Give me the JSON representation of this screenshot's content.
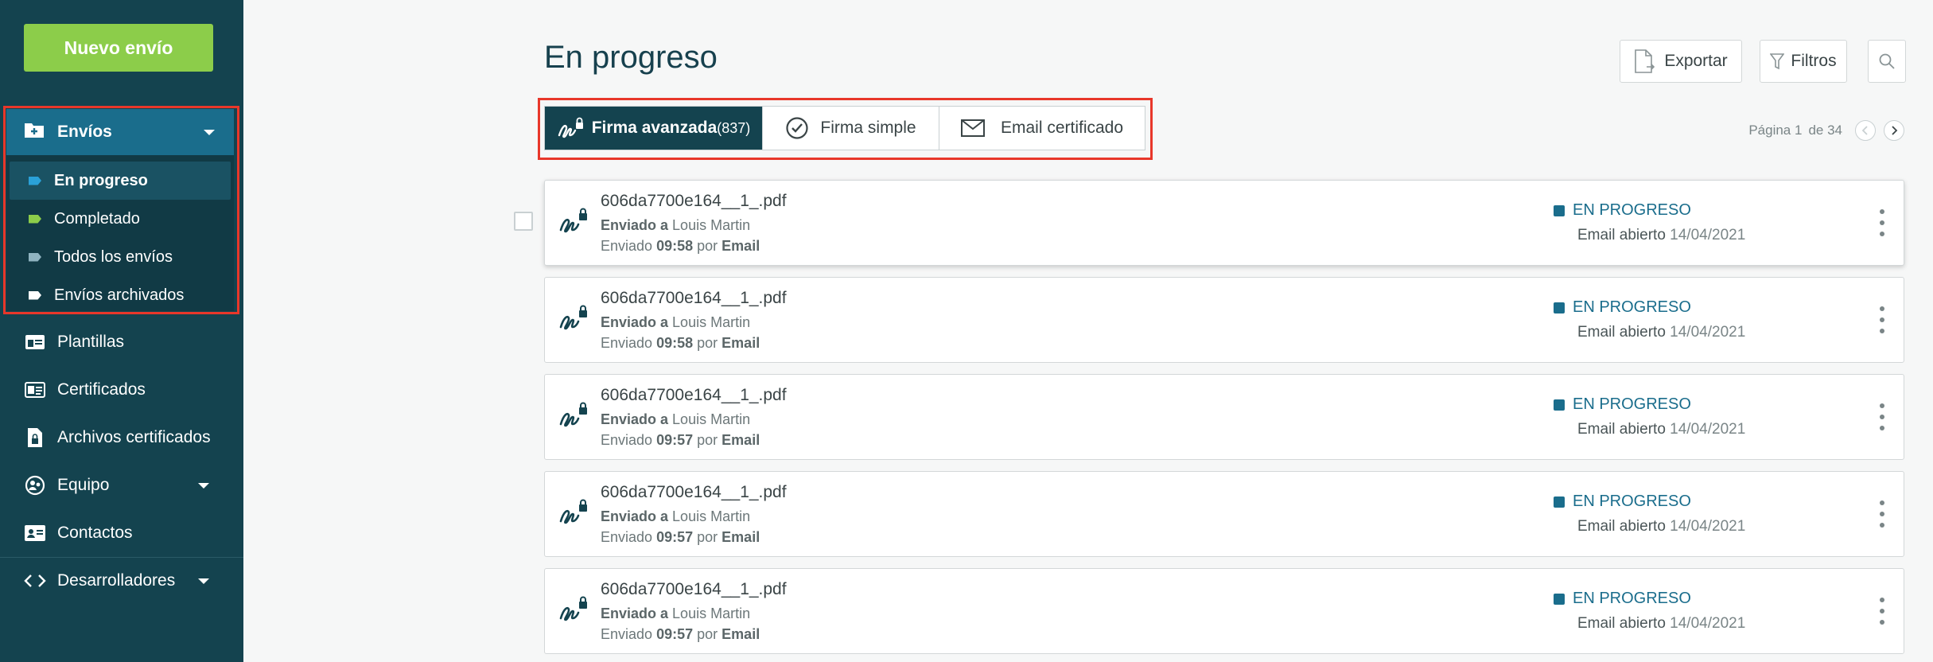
{
  "sidebar": {
    "new_button": "Nuevo envío",
    "envios_label": "Envíos",
    "sub_items": [
      {
        "label": "En progreso",
        "tag_color": "#2aa1d8"
      },
      {
        "label": "Completado",
        "tag_color": "#8ccd4a"
      },
      {
        "label": "Todos los envíos",
        "tag_color": "#8fb3c0"
      },
      {
        "label": "Envíos archivados",
        "tag_color": "#ffffff"
      }
    ],
    "nav_items": [
      {
        "label": "Plantillas",
        "icon": "template-icon"
      },
      {
        "label": "Certificados",
        "icon": "certificate-icon"
      },
      {
        "label": "Archivos certificados",
        "icon": "certified-file-icon"
      },
      {
        "label": "Equipo",
        "icon": "team-icon"
      },
      {
        "label": "Contactos",
        "icon": "contacts-icon"
      },
      {
        "label": "Desarrolladores",
        "icon": "code-icon"
      }
    ]
  },
  "main": {
    "title": "En progreso",
    "export_label": "Exportar",
    "filters_label": "Filtros",
    "tabs": [
      {
        "label": "Firma avanzada",
        "count": "(837)"
      },
      {
        "label": "Firma simple"
      },
      {
        "label": "Email certificado"
      }
    ],
    "pager": {
      "page_label": "Página 1",
      "of_label": "de 34"
    },
    "rows": [
      {
        "file": "606da7700e164__1_.pdf",
        "sent_to_label": "Enviado a",
        "recipient": "Louis Martin",
        "sent_label": "Enviado",
        "time": "09:58",
        "by_label": "por",
        "channel": "Email",
        "status": "EN PROGRESO",
        "opened_label": "Email abierto",
        "date": "14/04/2021"
      },
      {
        "file": "606da7700e164__1_.pdf",
        "sent_to_label": "Enviado a",
        "recipient": "Louis Martin",
        "sent_label": "Enviado",
        "time": "09:58",
        "by_label": "por",
        "channel": "Email",
        "status": "EN PROGRESO",
        "opened_label": "Email abierto",
        "date": "14/04/2021"
      },
      {
        "file": "606da7700e164__1_.pdf",
        "sent_to_label": "Enviado a",
        "recipient": "Louis Martin",
        "sent_label": "Enviado",
        "time": "09:57",
        "by_label": "por",
        "channel": "Email",
        "status": "EN PROGRESO",
        "opened_label": "Email abierto",
        "date": "14/04/2021"
      },
      {
        "file": "606da7700e164__1_.pdf",
        "sent_to_label": "Enviado a",
        "recipient": "Louis Martin",
        "sent_label": "Enviado",
        "time": "09:57",
        "by_label": "por",
        "channel": "Email",
        "status": "EN PROGRESO",
        "opened_label": "Email abierto",
        "date": "14/04/2021"
      },
      {
        "file": "606da7700e164__1_.pdf",
        "sent_to_label": "Enviado a",
        "recipient": "Louis Martin",
        "sent_label": "Enviado",
        "time": "09:57",
        "by_label": "por",
        "channel": "Email",
        "status": "EN PROGRESO",
        "opened_label": "Email abierto",
        "date": "14/04/2021"
      }
    ]
  },
  "colors": {
    "sidebar_bg": "#14434f",
    "accent_green": "#8ccd4a",
    "active_blue": "#1a6d8c",
    "highlight_red": "#e8372a"
  }
}
